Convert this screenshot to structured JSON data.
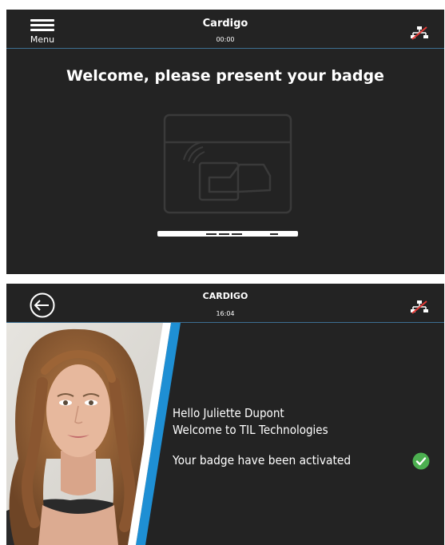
{
  "screen_badge": {
    "app_title": "Cardigo",
    "time": "00:00",
    "menu_label": "Menu",
    "prompt": "Welcome, please present your badge",
    "icons": {
      "menu": "hamburger-menu-icon",
      "network": "network-disconnected-icon",
      "reader": "badge-reader-icon"
    }
  },
  "screen_activated": {
    "app_title": "CARDIGO",
    "time": "16:04",
    "greeting_line1": "Hello Juliette Dupont",
    "greeting_line2": "Welcome to TIL Technologies",
    "status": "Your badge have been activated",
    "icons": {
      "back": "back-arrow-icon",
      "network": "network-disconnected-icon",
      "status": "check-circle-icon"
    }
  },
  "colors": {
    "background": "#232323",
    "divider": "#3d6f92",
    "accent_blue": "#1e8fd4",
    "success_green": "#4caf50",
    "alert_red": "#e53935"
  }
}
